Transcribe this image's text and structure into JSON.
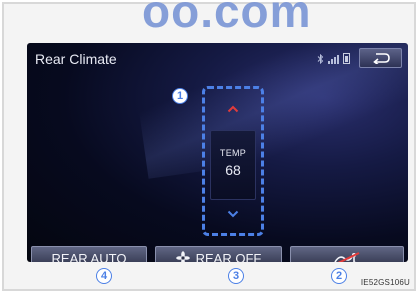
{
  "watermark": "oo.com",
  "screen": {
    "title": "Rear Climate",
    "status_icons": [
      "bluetooth-icon",
      "signal-strength-icon",
      "battery-icon"
    ],
    "back_icon": "back-arrow-icon"
  },
  "temperature": {
    "label": "TEMP",
    "value": "68",
    "up_icon": "chevron-up-icon",
    "down_icon": "chevron-down-icon"
  },
  "bottom_buttons": {
    "rear_auto": "REAR AUTO",
    "rear_off": "REAR OFF",
    "fan_icon": "fan-icon",
    "airflow_off_icon": "airflow-off-icon"
  },
  "callouts": [
    "1",
    "2",
    "3",
    "4"
  ],
  "image_code": "IE52GS106U",
  "colors": {
    "accent": "#4c80e6",
    "arrow_up": "#e23b3b",
    "arrow_down": "#4c80e6",
    "airflow_cross": "#e23b3b"
  }
}
